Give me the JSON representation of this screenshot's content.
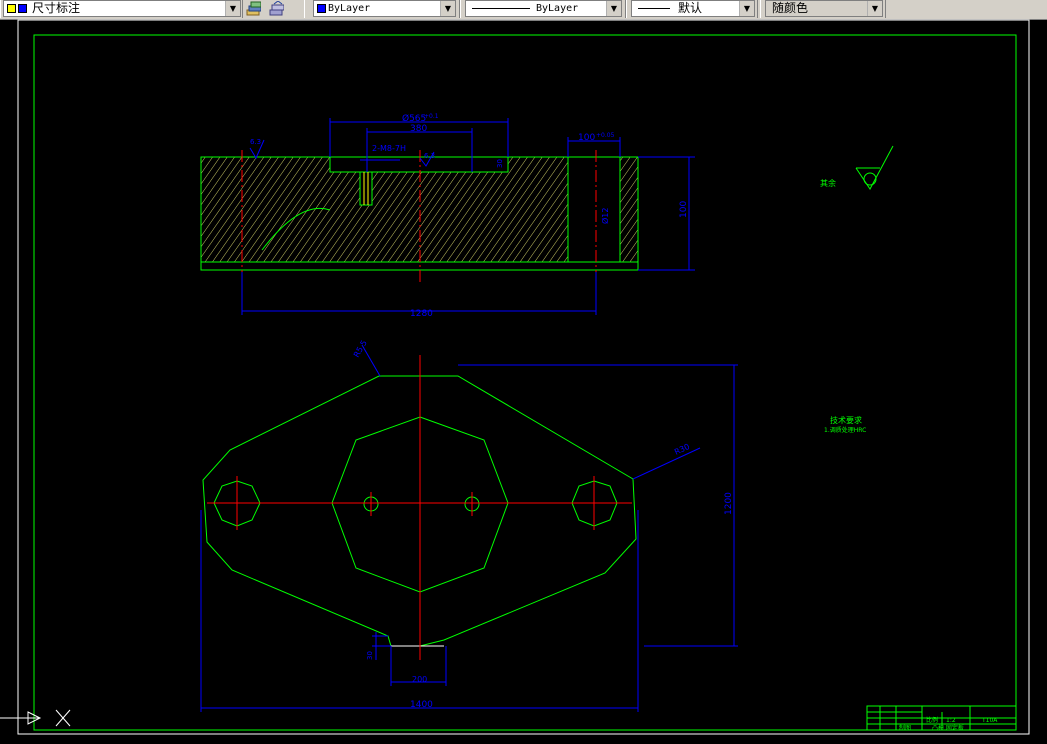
{
  "toolbar": {
    "dimstyle": "尺寸标注",
    "color": "ByLayer",
    "linetype": "ByLayer",
    "lineweight": "默认",
    "plotstyle": "随颜色"
  },
  "drawing": {
    "top_view": {
      "dia_label": "Ø565",
      "dia_tol": "+0.1",
      "width_380": "380",
      "thread": "2-M8-7H",
      "right_dim": "100",
      "right_tol": "+0.05",
      "height": "100",
      "length": "1280",
      "rough1": "6.3",
      "rough2": "6.3",
      "small_dim": "30",
      "side_dia": "Ø12"
    },
    "plan_view": {
      "angle_label": "R5.5",
      "radius_label": "R30",
      "height": "1200",
      "notch_w": "200",
      "notch_h": "30",
      "overall_w": "1400"
    },
    "surface_note": "其余",
    "tech_title": "技术要求",
    "tech_line": "1.调质处理HRC",
    "title_block": {
      "scale": "比例",
      "scale_val": "1:2",
      "material": "T10A",
      "name": "凸模 固定板",
      "drawn": "制图"
    }
  },
  "colors": {
    "frame": "#00ff00",
    "dim": "#0000ff",
    "center": "#ff0000",
    "hatch": "#ffff00"
  }
}
